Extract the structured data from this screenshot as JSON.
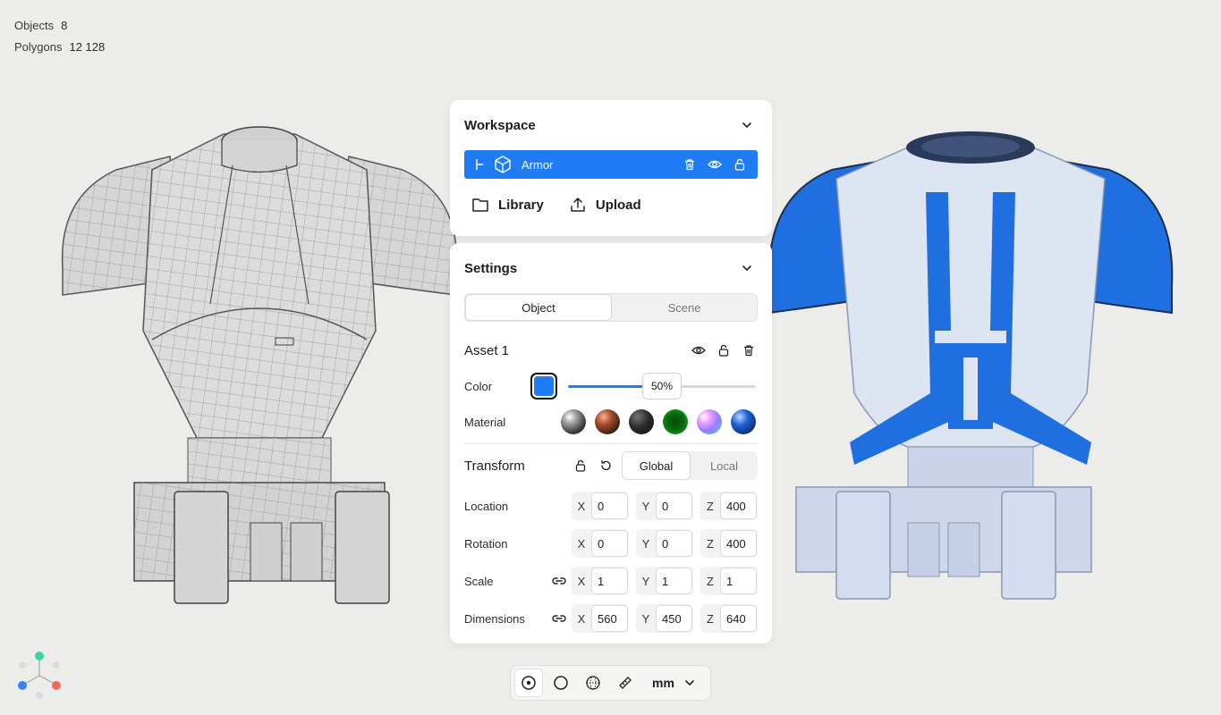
{
  "stats": {
    "objects_label": "Objects",
    "objects_value": "8",
    "polygons_label": "Polygons",
    "polygons_value": "12 128"
  },
  "workspace": {
    "title": "Workspace",
    "selected_item": "Armor",
    "library_label": "Library",
    "upload_label": "Upload"
  },
  "settings": {
    "title": "Settings",
    "tabs": [
      {
        "label": "Object",
        "active": true
      },
      {
        "label": "Scene",
        "active": false
      }
    ],
    "asset_title": "Asset 1",
    "color_label": "Color",
    "color_value": "#1f7cf5",
    "opacity": {
      "label": "50%",
      "fraction": 0.5
    },
    "material_label": "Material",
    "materials": [
      "chrome-sphere",
      "copper-sphere",
      "matte-black-sphere",
      "green-glow-sphere",
      "iridescent-sphere",
      "blue-gloss-sphere"
    ],
    "transform_title": "Transform",
    "space_tabs": [
      {
        "label": "Global",
        "active": true
      },
      {
        "label": "Local",
        "active": false
      }
    ],
    "rows": {
      "location": {
        "label": "Location",
        "x": "0",
        "y": "0",
        "z": "400"
      },
      "rotation": {
        "label": "Rotation",
        "x": "0",
        "y": "0",
        "z": "400"
      },
      "scale": {
        "label": "Scale",
        "x": "1",
        "y": "1",
        "z": "1"
      },
      "dimensions": {
        "label": "Dimensions",
        "x": "560",
        "y": "450",
        "z": "640"
      }
    },
    "axes": {
      "x": "X",
      "y": "Y",
      "z": "Z"
    }
  },
  "toolbar": {
    "unit": "mm"
  }
}
